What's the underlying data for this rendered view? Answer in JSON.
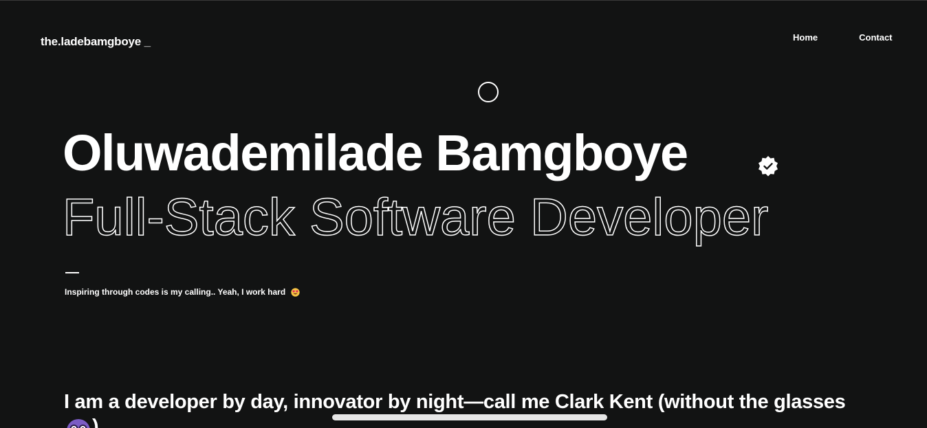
{
  "header": {
    "logo": "the.ladebamgboye _",
    "nav": [
      {
        "label": "Home"
      },
      {
        "label": "Contact"
      }
    ]
  },
  "hero": {
    "name": "Oluwademilade Bamgboye",
    "verified_icon": "verified-badge-icon",
    "role": "Full-Stack Software Developer",
    "tagline": "Inspiring through codes is my calling.. Yeah, I work hard",
    "tagline_emoji": "heart-eyes-emoji-icon"
  },
  "intro": {
    "text": "I am a developer by day, innovator by night—call me Clark Kent (without the glasses",
    "emoji": "nerd-face-emoji-icon",
    "trailing": ")"
  },
  "colors": {
    "background": "#121313",
    "text": "#ffffff",
    "scrollbar": "#e6e6e6"
  }
}
